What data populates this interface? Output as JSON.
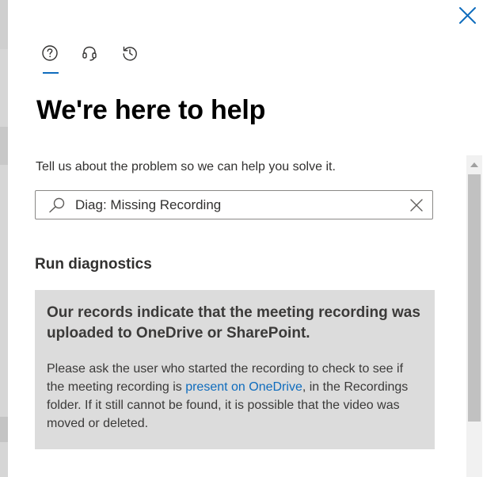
{
  "panel": {
    "title": "We're here to help",
    "subtitle": "Tell us about the problem so we can help you solve it."
  },
  "tabs": [
    {
      "icon": "help-circle-icon",
      "selected": true
    },
    {
      "icon": "headset-icon",
      "selected": false
    },
    {
      "icon": "history-icon",
      "selected": false
    }
  ],
  "search": {
    "value": "Diag: Missing Recording"
  },
  "diagnostics": {
    "heading": "Run diagnostics",
    "card_title": "Our records indicate that the meeting recording was uploaded to OneDrive or SharePoint.",
    "body_before": "Please ask the user who started the recording to check to see if the meeting recording is ",
    "link_text": "present on OneDrive",
    "body_after": ", in the Recordings folder. If it still cannot be found, it is possible that the video was moved or deleted."
  },
  "colors": {
    "accent": "#0f6cbd",
    "card_background": "#dcdcdc"
  }
}
